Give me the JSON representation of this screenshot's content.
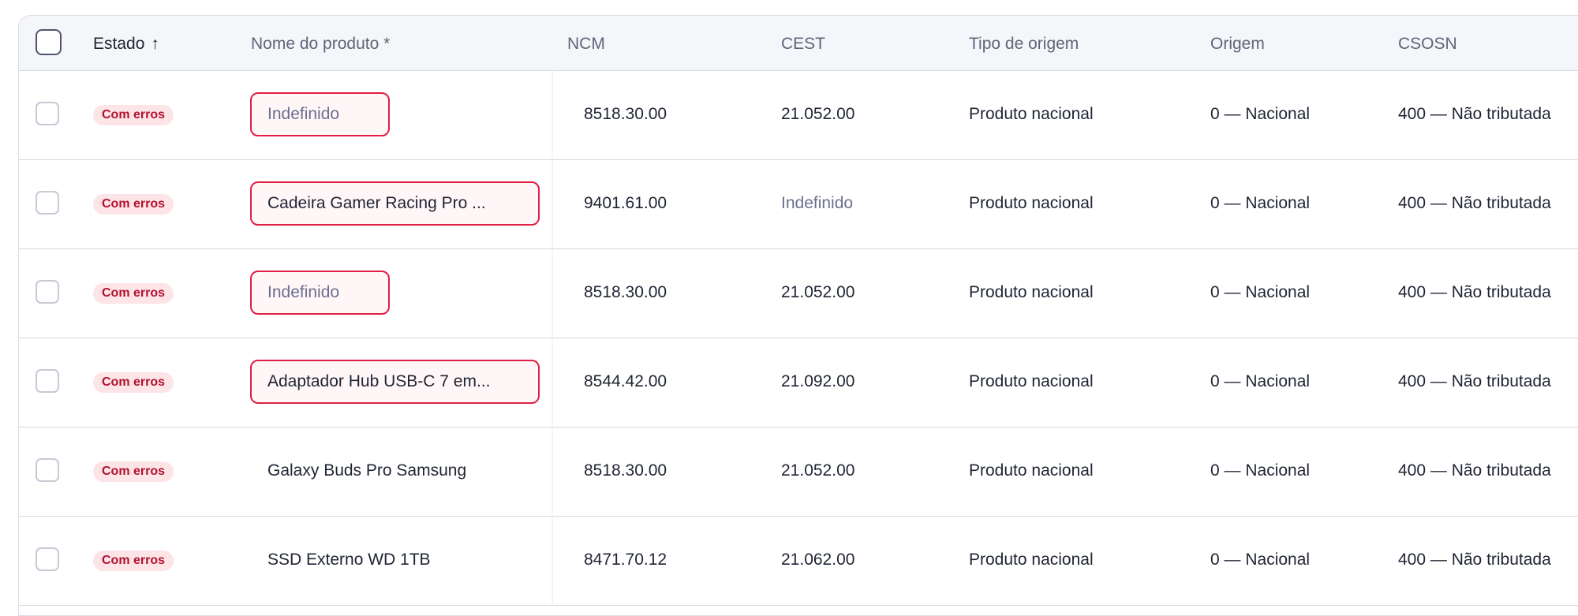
{
  "header": {
    "estado": "Estado",
    "sort_arrow": "↑",
    "nome": "Nome do produto *",
    "ncm": "NCM",
    "cest": "CEST",
    "tipo": "Tipo de origem",
    "origem": "Origem",
    "csosn": "CSOSN"
  },
  "rows": [
    {
      "estado": "Com erros",
      "nome": "Indefinido",
      "ncm": "8518.30.00",
      "cest": "21.052.00",
      "tipo": "Produto nacional",
      "origem": "0 — Nacional",
      "csosn": "400 — Não tributada"
    },
    {
      "estado": "Com erros",
      "nome": "Cadeira Gamer Racing Pro ...",
      "ncm": "9401.61.00",
      "cest": "Indefinido",
      "tipo": "Produto nacional",
      "origem": "0 — Nacional",
      "csosn": "400 — Não tributada"
    },
    {
      "estado": "Com erros",
      "nome": "Indefinido",
      "ncm": "8518.30.00",
      "cest": "21.052.00",
      "tipo": "Produto nacional",
      "origem": "0 — Nacional",
      "csosn": "400 — Não tributada"
    },
    {
      "estado": "Com erros",
      "nome": "Adaptador Hub USB-C 7 em...",
      "ncm": "8544.42.00",
      "cest": "21.092.00",
      "tipo": "Produto nacional",
      "origem": "0 — Nacional",
      "csosn": "400 — Não tributada"
    },
    {
      "estado": "Com erros",
      "nome": "Galaxy Buds Pro Samsung",
      "ncm": "8518.30.00",
      "cest": "21.052.00",
      "tipo": "Produto nacional",
      "origem": "0 — Nacional",
      "csosn": "400 — Não tributada"
    },
    {
      "estado": "Com erros",
      "nome": "SSD Externo WD 1TB",
      "ncm": "8471.70.12",
      "cest": "21.062.00",
      "tipo": "Produto nacional",
      "origem": "0 — Nacional",
      "csosn": "400 — Não tributada"
    }
  ],
  "colors": {
    "error_border": "#df1f44",
    "error_fill": "#fff6f7",
    "badge_bg": "#fde4e7",
    "badge_text": "#b2122f",
    "undefined_text": "#6b6f8f"
  }
}
